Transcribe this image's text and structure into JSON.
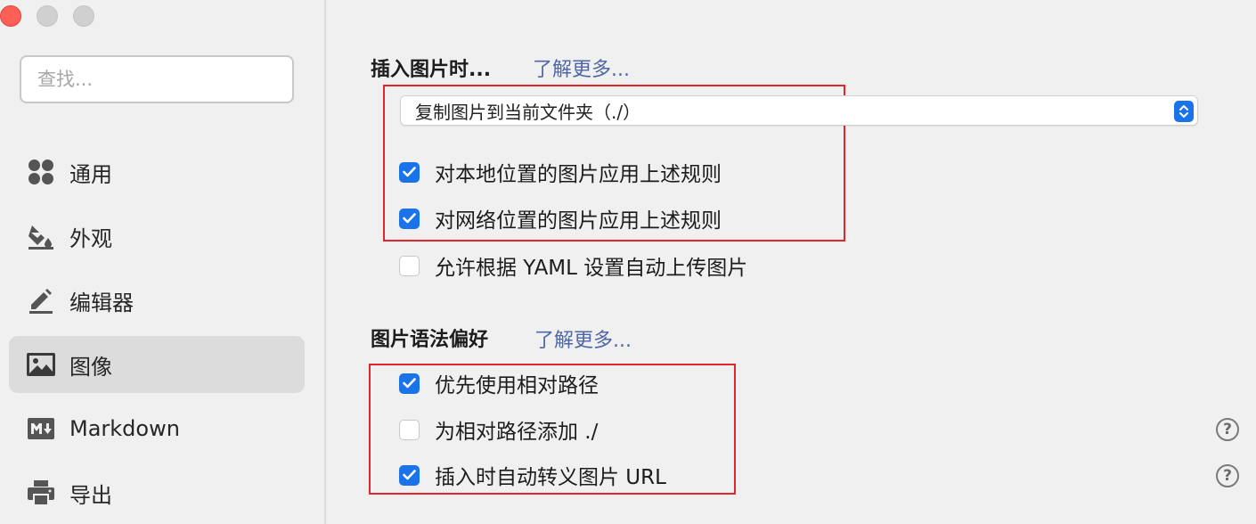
{
  "sidebar": {
    "search_placeholder": "查找...",
    "items": [
      {
        "label": "通用",
        "icon": "apps-icon",
        "active": false
      },
      {
        "label": "外观",
        "icon": "paint-bucket-icon",
        "active": false
      },
      {
        "label": "编辑器",
        "icon": "pencil-icon",
        "active": false
      },
      {
        "label": "图像",
        "icon": "image-icon",
        "active": true
      },
      {
        "label": "Markdown",
        "icon": "markdown-icon",
        "active": false
      },
      {
        "label": "导出",
        "icon": "printer-icon",
        "active": false
      }
    ]
  },
  "insert_section": {
    "title": "插入图片时...",
    "learn_more": "了解更多...",
    "select_value": "复制图片到当前文件夹（./）",
    "options": [
      {
        "label": "对本地位置的图片应用上述规则",
        "checked": true
      },
      {
        "label": "对网络位置的图片应用上述规则",
        "checked": true
      },
      {
        "label": "允许根据 YAML 设置自动上传图片",
        "checked": false
      }
    ]
  },
  "syntax_section": {
    "title": "图片语法偏好",
    "learn_more": "了解更多...",
    "options": [
      {
        "label": "优先使用相对路径",
        "checked": true
      },
      {
        "label": "为相对路径添加 ./",
        "checked": false
      },
      {
        "label": "插入时自动转义图片 URL",
        "checked": true
      }
    ],
    "help_symbol": "?"
  },
  "colors": {
    "accent": "#1a73e8",
    "highlight": "#e0262c",
    "link": "#4f67a6",
    "window_close": "#fe5f57"
  }
}
